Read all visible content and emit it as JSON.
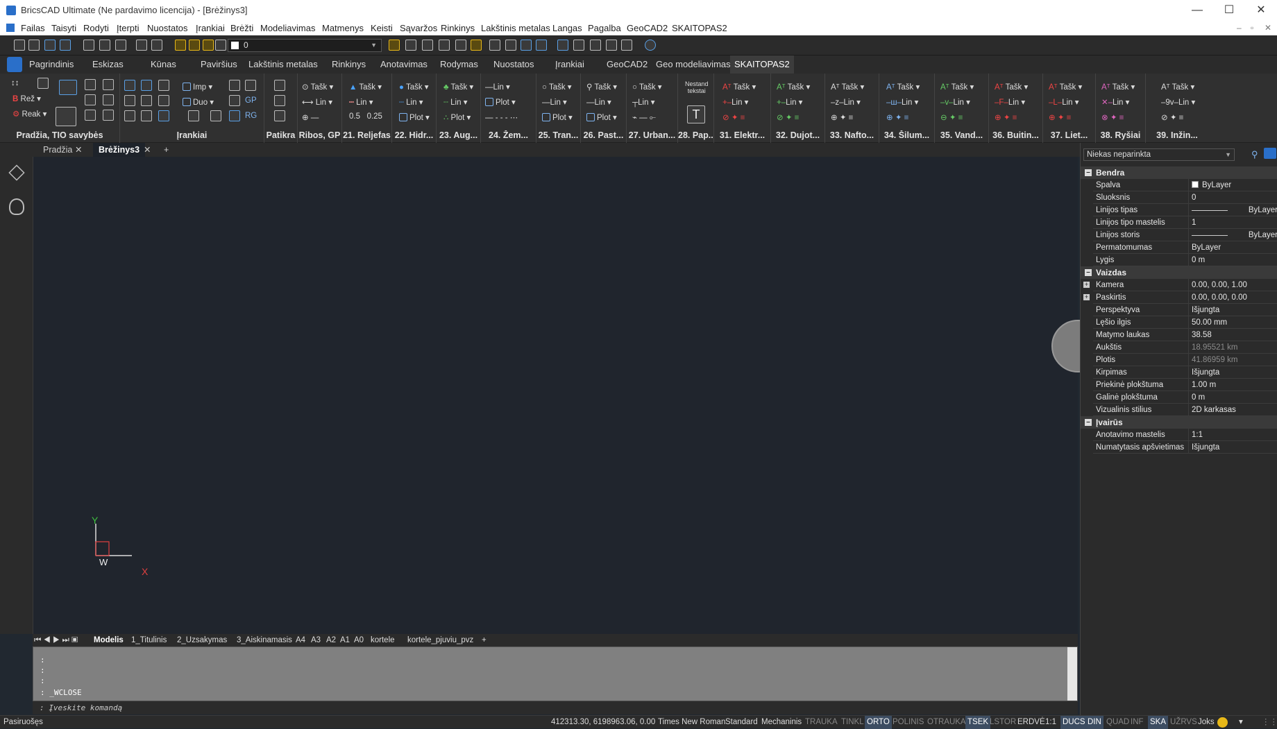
{
  "window": {
    "title": "BricsCAD Ultimate (Ne pardavimo licencija) - [Brėžinys3]"
  },
  "menu": [
    "Failas",
    "Taisyti",
    "Rodyti",
    "Įterpti",
    "Nuostatos",
    "Įrankiai",
    "Brėžti",
    "Modeliavimas",
    "Matmenys",
    "Keisti",
    "Sąvaržos",
    "Rinkinys",
    "Lakštinis metalas",
    "Langas",
    "Pagalba",
    "GeoCAD2",
    "SKAITOPAS2"
  ],
  "layer": {
    "current": "0"
  },
  "ribbon_tabs": [
    "Pagrindinis",
    "Eskizas",
    "Kūnas",
    "Paviršius",
    "Lakštinis metalas",
    "Rinkinys",
    "Anotavimas",
    "Rodymas",
    "Nuostatos",
    "Įrankiai",
    "GeoCAD2",
    "Geo modeliavimas",
    "SKAITOPAS2"
  ],
  "ribbon_panels": [
    "Pradžia, TIO savybės",
    "Įrankiai",
    "Patikra",
    "Ribos, GP",
    "21. Reljefas",
    "22. Hidr...",
    "23. Aug...",
    "24. Žem...",
    "25. Tran...",
    "26. Past...",
    "27. Urban...",
    "28. Pap...",
    "31. Elektr...",
    "32. Dujot...",
    "33. Nafto...",
    "34. Šilum...",
    "35. Vand...",
    "36. Buitin...",
    "37. Liet...",
    "38. Ryšiai",
    "39. Inžin..."
  ],
  "ribbon_labels": {
    "rez": "Rež",
    "reak": "Reak",
    "imp": "Imp",
    "duo": "Duo",
    "task": "Tašk",
    "lin": "Lin",
    "plot": "Plot",
    "nestand": "Nestand\ntekstai"
  },
  "doc_tabs": [
    "Pradžia",
    "Brėžinys3"
  ],
  "ucs": {
    "y": "Y",
    "x": "X",
    "w": "W"
  },
  "layout_tabs": [
    "Modelis",
    "1_Titulinis",
    "2_Uzsakymas",
    "3_Aiskinamasis",
    "A4",
    "A3",
    "A2",
    "A1",
    "A0",
    "kortele",
    "kortele_pjuviu_pvz"
  ],
  "command": {
    "history": [
      ":",
      ":",
      ":",
      ": _WCLOSE"
    ],
    "prompt": ": Įveskite komandą"
  },
  "status": {
    "left": "Pasiruošęs",
    "coords": "412313.30, 6198963.06, 0.00",
    "items": [
      {
        "t": "Times New Roman",
        "s": "n"
      },
      {
        "t": "Standard",
        "s": "n"
      },
      {
        "t": "Mechaninis",
        "s": "n"
      },
      {
        "t": "TRAUKA",
        "s": "off"
      },
      {
        "t": "TINKL",
        "s": "off"
      },
      {
        "t": "ORTO",
        "s": "on"
      },
      {
        "t": "POLINIS",
        "s": "off"
      },
      {
        "t": "OTRAUKA",
        "s": "off"
      },
      {
        "t": "TSEK",
        "s": "on"
      },
      {
        "t": "LSTOR",
        "s": "off"
      },
      {
        "t": "ERDVĖ",
        "s": "n"
      },
      {
        "t": "1:1",
        "s": "n"
      },
      {
        "t": "DUCS",
        "s": "on"
      },
      {
        "t": "DIN",
        "s": "on"
      },
      {
        "t": "QUAD",
        "s": "off"
      },
      {
        "t": "INF",
        "s": "off"
      },
      {
        "t": "SKA",
        "s": "on"
      },
      {
        "t": "UŽRVS",
        "s": "off"
      },
      {
        "t": "Joks",
        "s": "n"
      }
    ]
  },
  "properties": {
    "selection": "Niekas neparinkta",
    "sections": [
      {
        "name": "Bendra",
        "rows": [
          [
            "Spalva",
            "ByLayer"
          ],
          [
            "Sluoksnis",
            "0"
          ],
          [
            "Linijos tipas",
            "ByLayer"
          ],
          [
            "Linijos tipo mastelis",
            "1"
          ],
          [
            "Linijos storis",
            "ByLayer"
          ],
          [
            "Permatomumas",
            "ByLayer"
          ],
          [
            "Lygis",
            "0 m"
          ]
        ]
      },
      {
        "name": "Vaizdas",
        "rows": [
          [
            "Kamera",
            "0.00, 0.00, 1.00"
          ],
          [
            "Paskirtis",
            "0.00, 0.00, 0.00"
          ],
          [
            "Perspektyva",
            "Išjungta"
          ],
          [
            "Lęšio ilgis",
            "50.00 mm"
          ],
          [
            "Matymo laukas",
            "38.58"
          ],
          [
            "Aukštis",
            "18.95521 km"
          ],
          [
            "Plotis",
            "41.86959 km"
          ],
          [
            "Kirpimas",
            "Išjungta"
          ],
          [
            "Priekinė plokštuma",
            "1.00 m"
          ],
          [
            "Galinė plokštuma",
            "0 m"
          ],
          [
            "Vizualinis stilius",
            "2D karkasas"
          ]
        ]
      },
      {
        "name": "Įvairūs",
        "rows": [
          [
            "Anotavimo mastelis",
            "1:1"
          ],
          [
            "Numatytasis apšvietimas",
            "Išjungta"
          ]
        ]
      }
    ]
  },
  "colors": {
    "accent": "#2a6fc9",
    "canvas": "#20252d",
    "x_axis": "#e04040",
    "y_axis": "#40c040"
  }
}
